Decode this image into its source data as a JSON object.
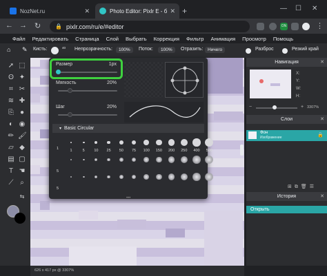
{
  "browser": {
    "tabs": [
      {
        "title": "NozNet.ru",
        "favicon_color": "#1a73e8",
        "active": false
      },
      {
        "title": "Photo Editor: Pixlr E - бесплатн",
        "favicon_color": "#31c6c6",
        "active": true
      }
    ],
    "new_tab_symbol": "+",
    "address": "pixlr.com/ru/e/#editor",
    "window_controls": {
      "minimize": "—",
      "maximize": "☐",
      "close": "✕"
    },
    "extension_badge": "ON"
  },
  "menu": [
    "Файл",
    "Редактировать",
    "Страница",
    "Слой",
    "Выбрать",
    "Коррекция",
    "Фильтр",
    "Анимация",
    "Просмотр",
    "Помощь"
  ],
  "toolbar": {
    "brush_label": "Кисть:",
    "brush_size_badge": "40",
    "opacity_label": "Непрозрачность:",
    "opacity_value": "100%",
    "flow_label": "Поток:",
    "flow_value": "100%",
    "reflect_label": "Отразить:",
    "reflect_value": "Ничего",
    "scatter_label": "Разброс",
    "sharp_label": "Резкий край"
  },
  "brush_popup": {
    "size_label": "Размер",
    "size_value": "1px",
    "size_fraction": 0.0,
    "softness_label": "Мягкость",
    "softness_value": "20%",
    "softness_fraction": 0.2,
    "step_label": "Шаг",
    "step_value": "20%",
    "step_fraction": 0.2,
    "preset_section": "Basic Circular",
    "row1_sizes": [
      "1",
      "5",
      "10",
      "25",
      "50",
      "75",
      "100",
      "150",
      "200",
      "250",
      "400",
      "500"
    ],
    "row_labels": [
      "1",
      "5",
      "5"
    ]
  },
  "navigator": {
    "title": "Навигация",
    "x_label": "X:",
    "y_label": "Y:",
    "w_label": "W:",
    "h_label": "H:",
    "zoom": "3307%"
  },
  "layers": {
    "title": "Слои",
    "items": [
      {
        "name": "Фон",
        "subtitle": "Изображение"
      }
    ]
  },
  "history": {
    "title": "История",
    "items": [
      "Открыть"
    ]
  },
  "status": "626 x 417 px @ 3307%",
  "colors": {
    "accent": "#31c6c6",
    "highlight_box": "#3fd13f",
    "primary_swatch": "#8c8da6",
    "secondary_swatch": "#000000"
  }
}
